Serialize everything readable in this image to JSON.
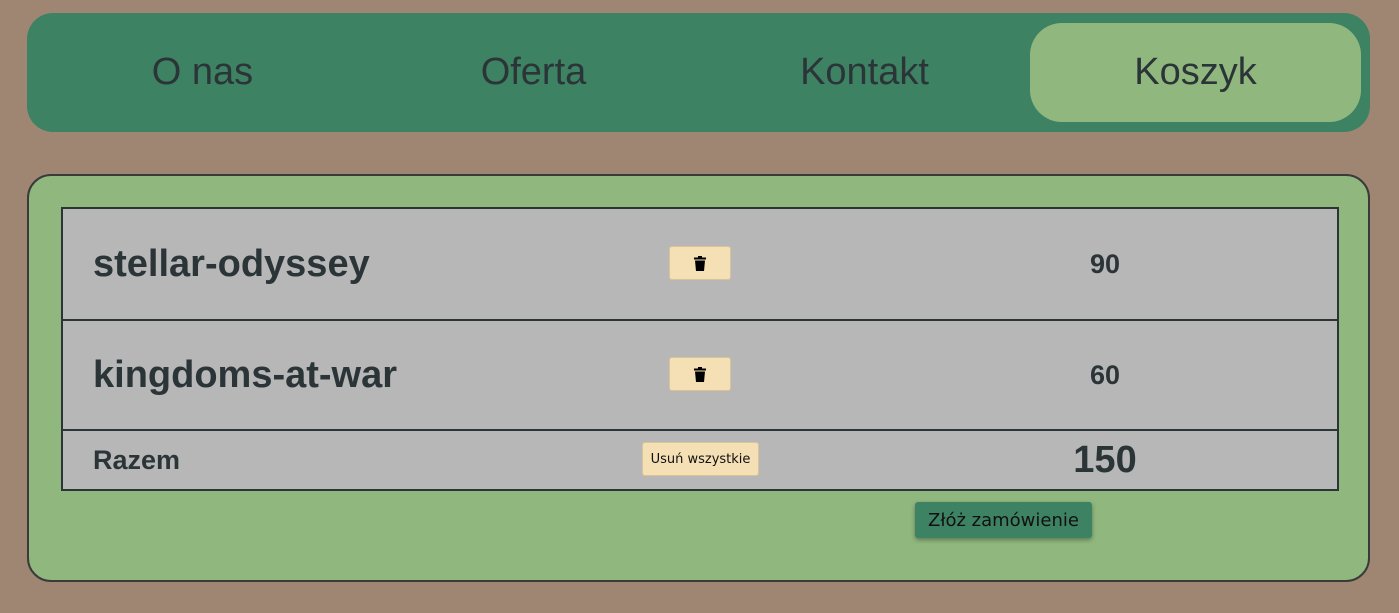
{
  "nav": {
    "items": [
      {
        "label": "O nas",
        "active": false
      },
      {
        "label": "Oferta",
        "active": false
      },
      {
        "label": "Kontakt",
        "active": false
      },
      {
        "label": "Koszyk",
        "active": true
      }
    ]
  },
  "cart": {
    "items": [
      {
        "name": "stellar-odyssey",
        "price": "90",
        "remove_icon": "trash-icon"
      },
      {
        "name": "kingdoms-at-war",
        "price": "60",
        "remove_icon": "trash-icon"
      }
    ],
    "total": {
      "label": "Razem",
      "clear_label": "Usuń wszystkie",
      "value": "150"
    },
    "order_label": "Złóż zamówienie"
  },
  "colors": {
    "background": "#9f8672",
    "nav_bg": "#3e8264",
    "nav_active": "#90b87e",
    "panel_bg": "#90b87e",
    "table_bg": "#b7b7b7",
    "button_bg": "#f5dfb5",
    "order_button_bg": "#3e8264",
    "text": "#2b3538"
  }
}
